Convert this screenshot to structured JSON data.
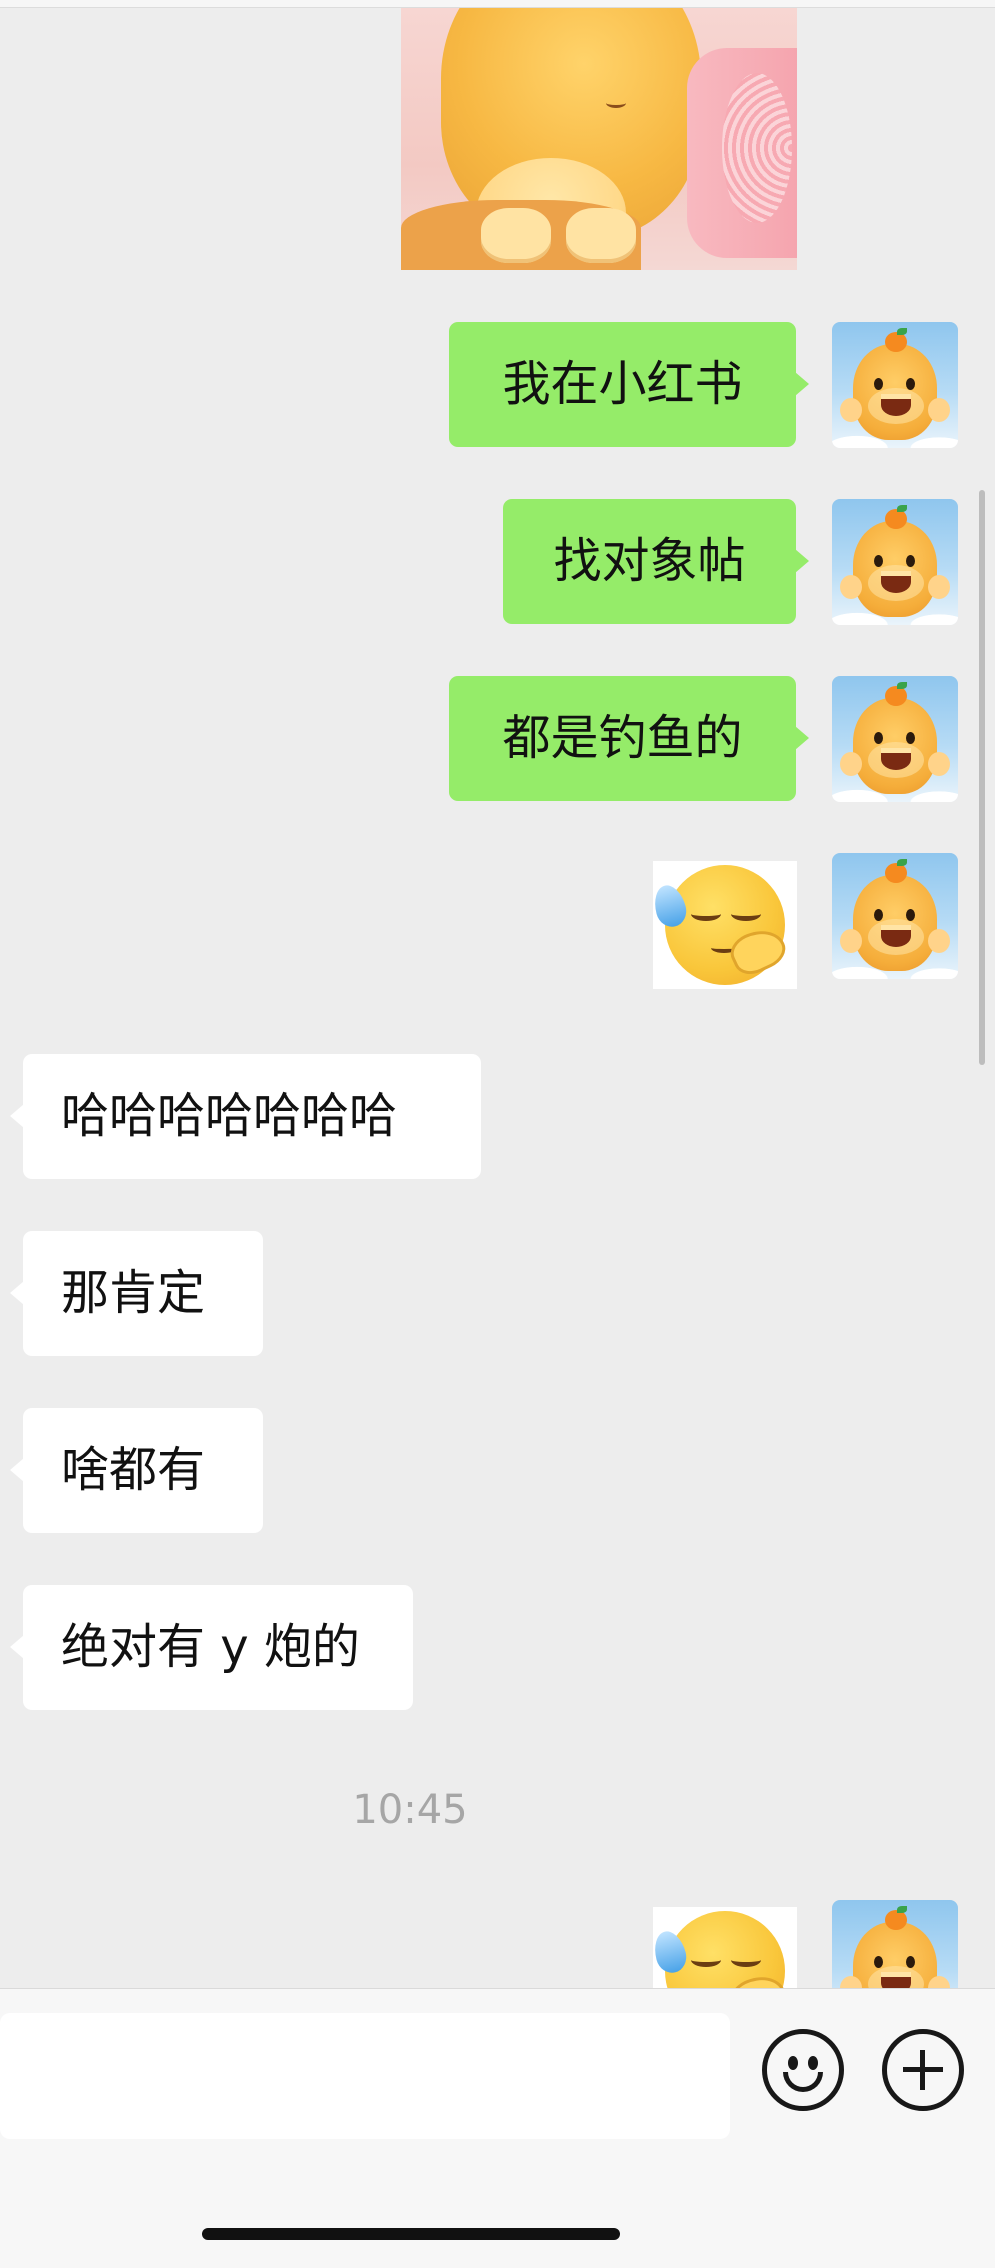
{
  "messages": [
    {
      "id": "m1",
      "side": "me",
      "type": "text",
      "text": "我在小红书"
    },
    {
      "id": "m2",
      "side": "me",
      "type": "text",
      "text": "找对象帖"
    },
    {
      "id": "m3",
      "side": "me",
      "type": "text",
      "text": "都是钓鱼的"
    },
    {
      "id": "m4",
      "side": "me",
      "type": "sticker",
      "icon": "sweat-smile-emoji-sticker"
    },
    {
      "id": "m5",
      "side": "them",
      "type": "text",
      "text": "哈哈哈哈哈哈哈"
    },
    {
      "id": "m6",
      "side": "them",
      "type": "text",
      "text": "那肯定"
    },
    {
      "id": "m7",
      "side": "them",
      "type": "text",
      "text": "啥都有"
    },
    {
      "id": "m8",
      "side": "them",
      "type": "text",
      "text": "绝对有 y 炮的"
    }
  ],
  "timestamp": "10:45",
  "input": {
    "value": "",
    "placeholder": ""
  },
  "icons": {
    "emoji_button": "smiley-icon",
    "more_button": "plus-circle-icon",
    "avatar": "orange-capybara-avatar"
  },
  "colors": {
    "my_bubble": "#95ec69",
    "their_bubble": "#ffffff",
    "background": "#ededed"
  }
}
